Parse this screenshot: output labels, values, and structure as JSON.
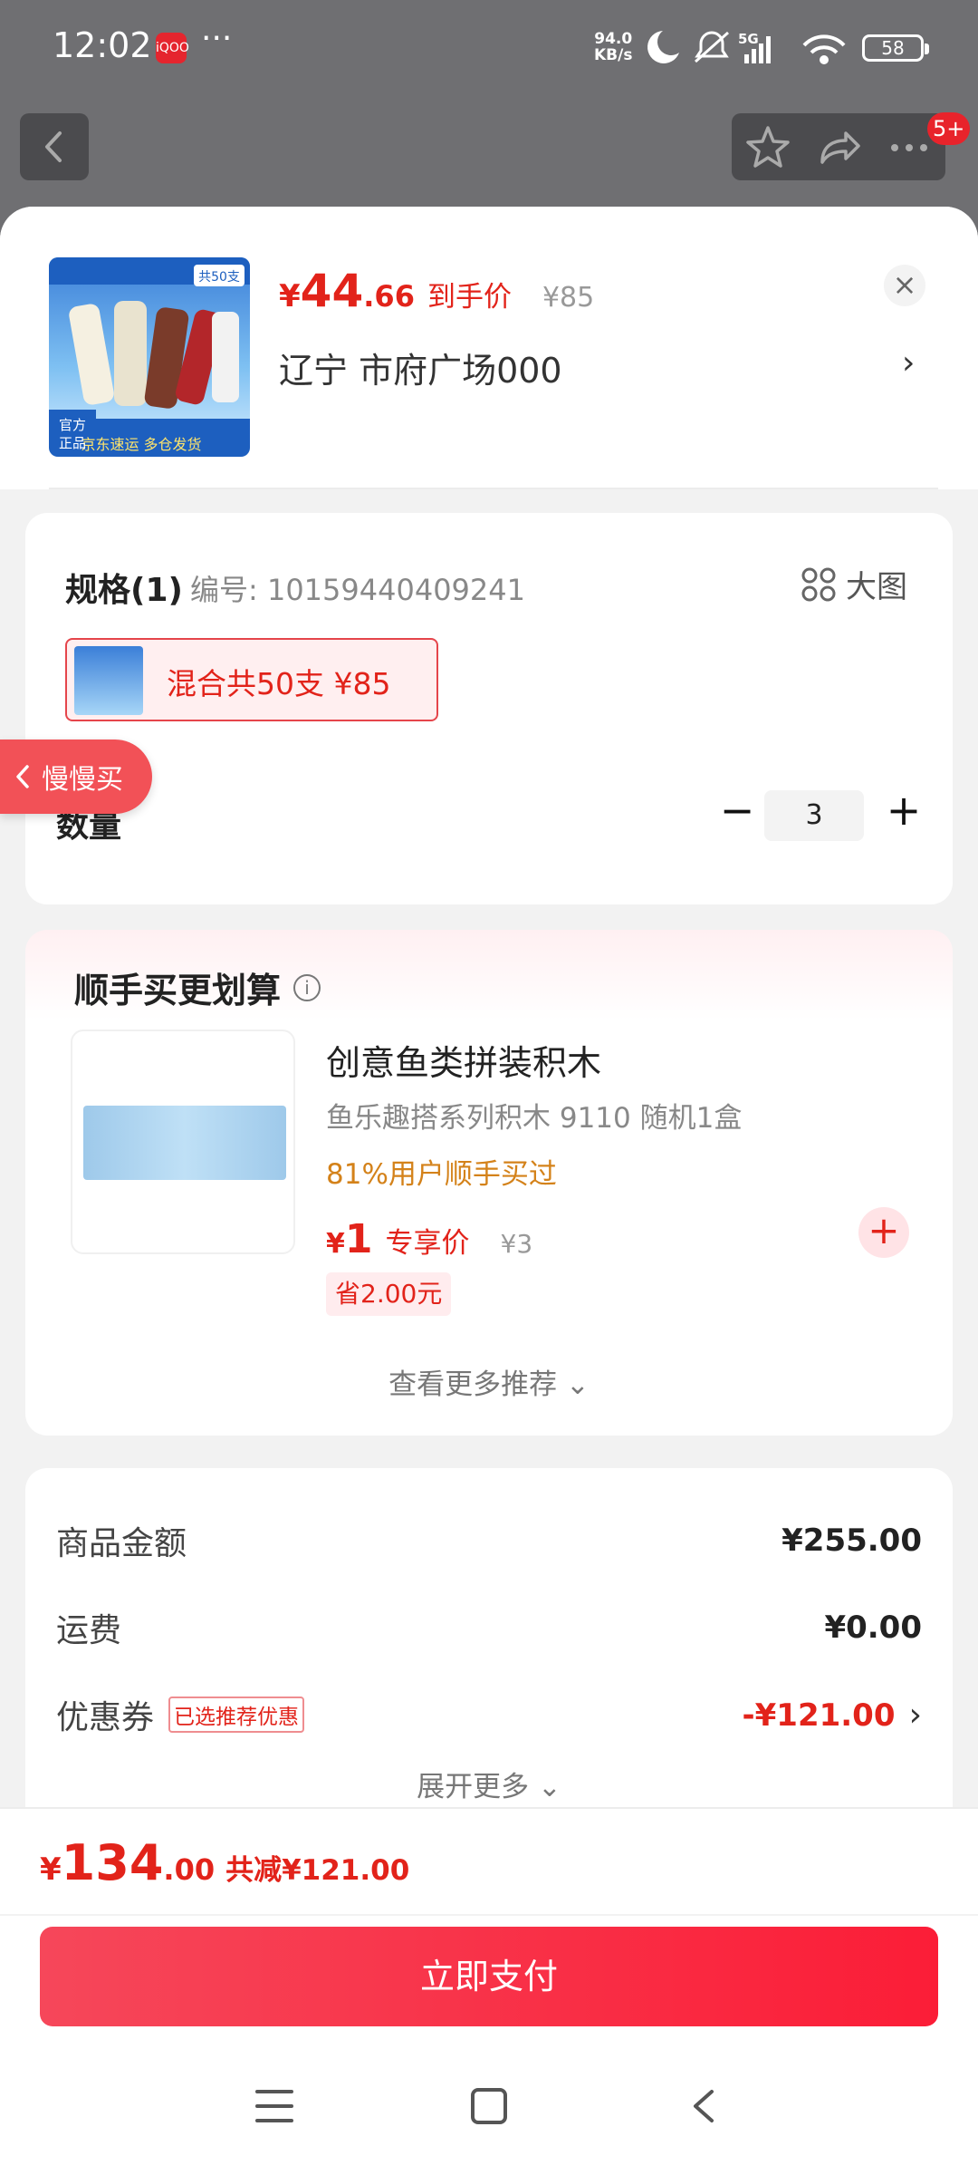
{
  "status_bar": {
    "time": "12:02",
    "app_icon_text": "iQOO",
    "more": "···",
    "net_speed_value": "94.0",
    "net_speed_unit": "KB/s",
    "network": "5G",
    "battery": "58"
  },
  "top_nav": {
    "badge": "5+"
  },
  "header": {
    "price_currency": "¥",
    "price_int": "44",
    "price_dec": ".66",
    "price_tag": "到手价",
    "original_price": "¥85",
    "address": "辽宁  市府广场000",
    "close": "×",
    "image_badge": "共50支",
    "image_corner_text": "官方\n正品",
    "image_footer": "京东速运 多仓发货"
  },
  "spec": {
    "title": "规格(1)",
    "code": "编号: 10159440409241",
    "big_view": "大图",
    "option_label": "混合共50支  ¥85",
    "quantity_label": "数量",
    "quantity": "3",
    "minus": "−",
    "plus": "+"
  },
  "slow_buy": {
    "label": "慢慢买"
  },
  "recommend": {
    "title": "顺手买更划算",
    "info_icon": "i",
    "product_name": "创意鱼类拼装积木",
    "product_desc": "鱼乐趣搭系列积木 9110 随机1盒",
    "buyers": "81%用户顺手买过",
    "price_currency": "¥",
    "price_int": "1",
    "price_tag": "专享价",
    "original_price": "¥3",
    "save": "省2.00元",
    "add": "+",
    "more": "查看更多推荐 ⌄"
  },
  "summary": {
    "rows": [
      {
        "label": "商品金额",
        "value": "¥255.00"
      },
      {
        "label": "运费",
        "value": "¥0.00"
      },
      {
        "label": "优惠券",
        "tag": "已选推荐优惠",
        "value": "-¥121.00",
        "arrow": "›"
      }
    ],
    "more": "展开更多 ⌄"
  },
  "bottom": {
    "total_currency": "¥",
    "total_int": "134",
    "total_dec": ".00",
    "reduce": "共减¥121.00",
    "pay_button": "立即支付"
  },
  "colors": {
    "accent": "#e2231a",
    "pay_gradient_start": "#f6475a",
    "pay_gradient_end": "#fb1d37"
  }
}
